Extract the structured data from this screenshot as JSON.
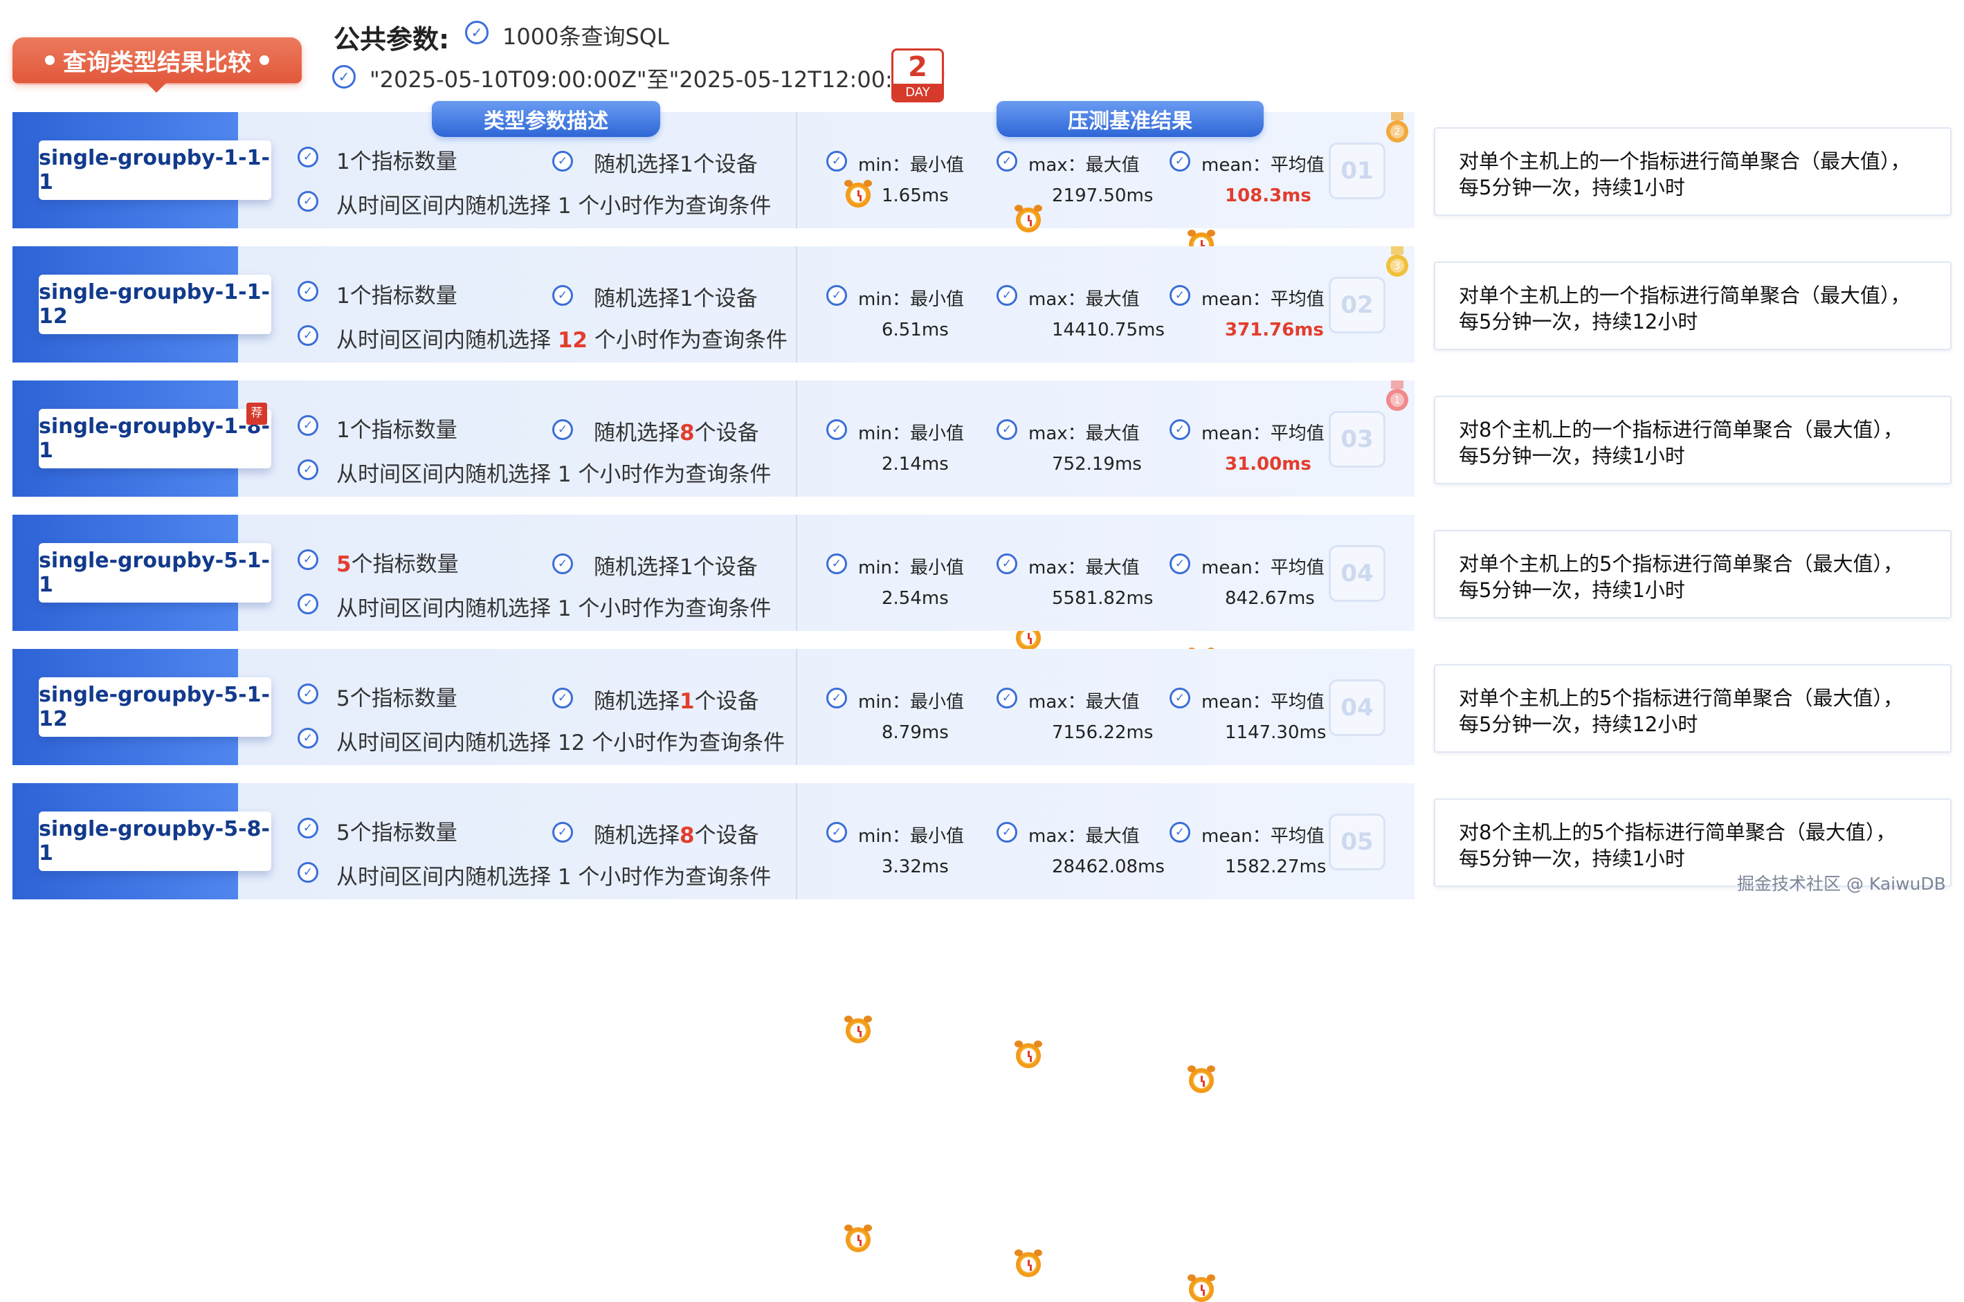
{
  "title": "查询类型结果比较",
  "public_params": {
    "label": "公共参数:",
    "sql_count": "1000条查询SQL",
    "time_range": "\"2025-05-10T09:00:00Z\"至\"2025-05-12T12:00:00Z\"",
    "day_number": "2",
    "day_label": "DAY"
  },
  "headers": {
    "params": "类型参数描述",
    "results": "压测基准结果"
  },
  "metric_labels": {
    "min": "min：最小值",
    "max": "max：最大值",
    "mean": "mean：平均值"
  },
  "rows": [
    {
      "name": "single-groupby-1-1-1",
      "metrics_pre": "",
      "metrics_hl": "",
      "metrics_post": "1个指标数量",
      "device_pre": "随机选择",
      "device_hl": "",
      "device_post": "1个设备",
      "time_pre": "从时间区间内随机选择 ",
      "time_hl": "",
      "time_post": "1 个小时作为查询条件",
      "min": "1.65ms",
      "max": "2197.50ms",
      "mean": "108.3ms",
      "index": "01",
      "desc1": "对单个主机上的一个指标进行简单聚合（最大值），",
      "desc2": "每5分钟一次，持续1小时"
    },
    {
      "name": "single-groupby-1-1-12",
      "metrics_pre": "",
      "metrics_hl": "",
      "metrics_post": "1个指标数量",
      "device_pre": "随机选择",
      "device_hl": "",
      "device_post": "1个设备",
      "time_pre": "从时间区间内随机选择 ",
      "time_hl": "12",
      "time_post": " 个小时作为查询条件",
      "min": "6.51ms",
      "max": "14410.75ms",
      "mean": "371.76ms",
      "index": "02",
      "desc1": "对单个主机上的一个指标进行简单聚合（最大值），",
      "desc2": "每5分钟一次，持续12小时"
    },
    {
      "name": "single-groupby-1-8-1",
      "tag": "荐",
      "metrics_pre": "",
      "metrics_hl": "",
      "metrics_post": "1个指标数量",
      "device_pre": "随机选择",
      "device_hl": "8",
      "device_post": "个设备",
      "time_pre": "从时间区间内随机选择 ",
      "time_hl": "",
      "time_post": "1 个小时作为查询条件",
      "min": "2.14ms",
      "max": "752.19ms",
      "mean": "31.00ms",
      "index": "03",
      "desc1": "对8个主机上的一个指标进行简单聚合（最大值），",
      "desc2": "每5分钟一次，持续1小时"
    },
    {
      "name": "single-groupby-5-1-1",
      "metrics_pre": "",
      "metrics_hl": "5",
      "metrics_post": "个指标数量",
      "device_pre": "随机选择",
      "device_hl": "",
      "device_post": "1个设备",
      "time_pre": "从时间区间内随机选择 ",
      "time_hl": "",
      "time_post": "1 个小时作为查询条件",
      "min": "2.54ms",
      "max": "5581.82ms",
      "mean": "842.67ms",
      "index": "04",
      "desc1": "对单个主机上的5个指标进行简单聚合（最大值），",
      "desc2": "每5分钟一次，持续1小时"
    },
    {
      "name": "single-groupby-5-1-12",
      "metrics_pre": "",
      "metrics_hl": "",
      "metrics_post": "5个指标数量",
      "device_pre": "随机选择",
      "device_hl": "1",
      "device_post": "个设备",
      "time_pre": "从时间区间内随机选择 ",
      "time_hl": "",
      "time_post": "12 个小时作为查询条件",
      "min": "8.79ms",
      "max": "7156.22ms",
      "mean": "1147.30ms",
      "index": "04",
      "desc1": "对单个主机上的5个指标进行简单聚合（最大值），",
      "desc2": "每5分钟一次，持续12小时"
    },
    {
      "name": "single-groupby-5-8-1",
      "metrics_pre": "",
      "metrics_hl": "",
      "metrics_post": "5个指标数量",
      "device_pre": "随机选择",
      "device_hl": "8",
      "device_post": "个设备",
      "time_pre": "从时间区间内随机选择 ",
      "time_hl": "",
      "time_post": "1 个小时作为查询条件",
      "min": "3.32ms",
      "max": "28462.08ms",
      "mean": "1582.27ms",
      "index": "05",
      "desc1": "对8个主机上的5个指标进行简单聚合（最大值），",
      "desc2": "每5分钟一次，持续1小时"
    }
  ],
  "medals": [
    {
      "rank": "2",
      "color": "#f2a93b"
    },
    {
      "rank": "3",
      "color": "#f2c03b"
    },
    {
      "rank": "1",
      "color": "#f08a8a"
    }
  ],
  "watermark": "掘金技术社区 @ KaiwuDB",
  "colors": {
    "accent_blue": "#2e63d6",
    "highlight_red": "#e23d2d",
    "title_orange": "#e2583b"
  }
}
